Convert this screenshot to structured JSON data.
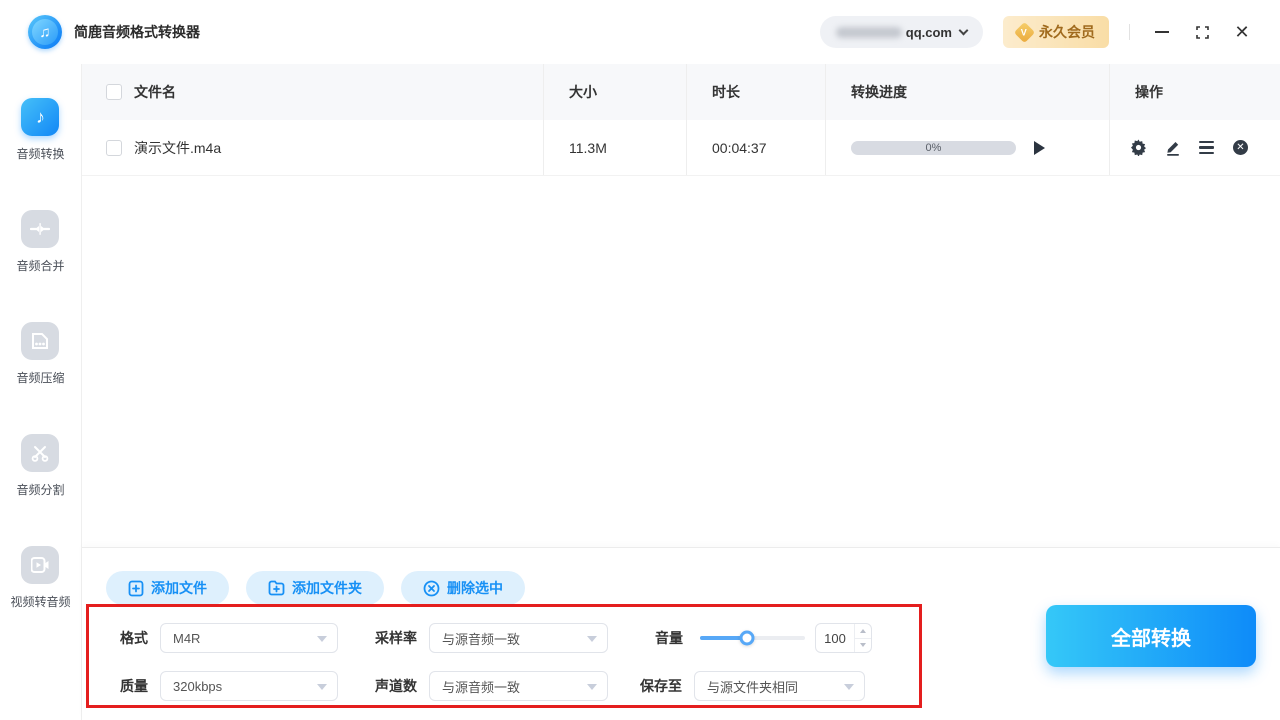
{
  "titlebar": {
    "app_title": "简鹿音频格式转换器",
    "account": {
      "email_visible": "qq.com"
    },
    "member_badge": {
      "icon": "vip-gem-icon",
      "gem_letter": "V",
      "label": "永久会员"
    },
    "window_controls": {
      "minimize": "minimize",
      "maximize": "maximize",
      "close": "✕"
    }
  },
  "sidebar": {
    "items": [
      {
        "label": "音频转换",
        "icon": "music-note-icon",
        "active": true
      },
      {
        "label": "音频合并",
        "icon": "merge-icon",
        "active": false
      },
      {
        "label": "音频压缩",
        "icon": "compress-file-icon",
        "active": false
      },
      {
        "label": "音频分割",
        "icon": "scissors-icon",
        "active": false
      },
      {
        "label": "视频转音频",
        "icon": "video-camera-icon",
        "active": false
      }
    ]
  },
  "table": {
    "headers": {
      "filename": "文件名",
      "size": "大小",
      "duration": "时长",
      "progress": "转换进度",
      "actions": "操作"
    },
    "rows": [
      {
        "filename": "演示文件.m4a",
        "size": "11.3M",
        "duration": "00:04:37",
        "progress_label": "0%",
        "progress_value": 0,
        "action_icons": [
          "gear-icon",
          "edit-icon",
          "menu-icon",
          "remove-icon"
        ]
      }
    ]
  },
  "toolbar": {
    "add_file": "添加文件",
    "add_folder": "添加文件夹",
    "delete_selected": "删除选中"
  },
  "settings": {
    "format": {
      "label": "格式",
      "value": "M4R"
    },
    "sample_rate": {
      "label": "采样率",
      "value": "与源音频一致"
    },
    "volume": {
      "label": "音量",
      "value": "100",
      "slider_percent": 45
    },
    "quality": {
      "label": "质量",
      "value": "320kbps"
    },
    "channels": {
      "label": "声道数",
      "value": "与源音频一致"
    },
    "save_to": {
      "label": "保存至",
      "value": "与源文件夹相同"
    }
  },
  "convert_all_label": "全部转换",
  "colors": {
    "accent_blue": "#1790f5",
    "button_gradient_start": "#35c8f8",
    "button_gradient_end": "#0e8bf9",
    "pill_bg": "#def0fd",
    "badge_bg": "#f9dda6",
    "badge_text": "#a06a1d",
    "highlight_red": "#e41e1e",
    "progress_track": "#d8dbe2",
    "header_bg": "#f7f8fa"
  }
}
